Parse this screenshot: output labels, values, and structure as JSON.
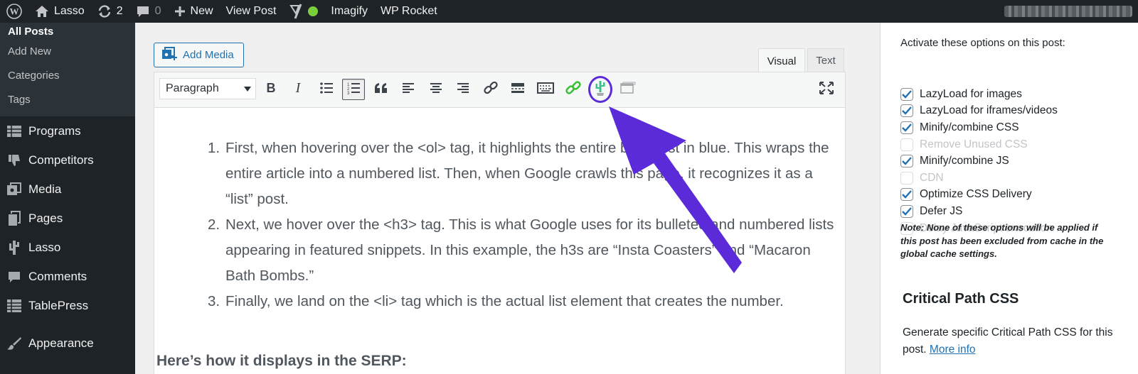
{
  "adminbar": {
    "site_name": "Lasso",
    "updates_count": "2",
    "comments_count": "0",
    "new_label": "New",
    "view_post_label": "View Post",
    "imagify_label": "Imagify",
    "wprocket_label": "WP Rocket"
  },
  "sidebar": {
    "submenu": [
      "All Posts",
      "Add New",
      "Categories",
      "Tags"
    ],
    "items": [
      {
        "label": "Programs",
        "icon": "table-icon"
      },
      {
        "label": "Competitors",
        "icon": "thumbs-down-icon"
      },
      {
        "label": "Media",
        "icon": "media-icon"
      },
      {
        "label": "Pages",
        "icon": "pages-icon"
      },
      {
        "label": "Lasso",
        "icon": "lasso-icon"
      },
      {
        "label": "Comments",
        "icon": "comments-icon"
      },
      {
        "label": "TablePress",
        "icon": "table-icon"
      },
      {
        "label": "Appearance",
        "icon": "paintbrush-icon"
      }
    ]
  },
  "editor": {
    "add_media_label": "Add Media",
    "tab_visual": "Visual",
    "tab_text": "Text",
    "format_select": "Paragraph",
    "list_items": [
      {
        "num": "1.",
        "text": "First, when hovering over the <ol> tag, it highlights the entire blog post in blue. This wraps the entire article into a numbered list. Then, when Google crawls this page, it recognizes it as a “list” post."
      },
      {
        "num": "2.",
        "text": "Next, we hover over the <h3> tag. This is what Google uses for its bulleted and numbered lists appearing in featured snippets. In this example, the h3s are “Insta Coasters” and “Macaron Bath Bombs.”"
      },
      {
        "num": "3.",
        "text": "Finally, we land on the <li> tag which is the actual list element that creates the number."
      }
    ],
    "heading": "Here’s how it displays in the SERP:"
  },
  "rightpanel": {
    "heading": "Activate these options on this post:",
    "options": [
      {
        "label": "LazyLoad for images",
        "checked": true
      },
      {
        "label": "LazyLoad for iframes/videos",
        "checked": true
      },
      {
        "label": "Minify/combine CSS",
        "checked": true
      },
      {
        "label": "Remove Unused CSS",
        "checked": false
      },
      {
        "label": "Minify/combine JS",
        "checked": true
      },
      {
        "label": "CDN",
        "checked": false
      },
      {
        "label": "Optimize CSS Delivery",
        "checked": true
      },
      {
        "label": "Defer JS",
        "checked": true
      },
      {
        "label": "Delay JavaScript execution",
        "checked": false
      }
    ],
    "note": "Note: None of these options will be applied if this post has been excluded from cache in the global cache settings.",
    "critical_title": "Critical Path CSS",
    "critical_desc": "Generate specific Critical Path CSS for this post.",
    "more_info": "More info"
  },
  "colors": {
    "admin_dark": "#1d2327",
    "wp_blue": "#2271b1",
    "annotation_purple": "#5b2bd9",
    "lasso_green": "#3dbf8e"
  }
}
